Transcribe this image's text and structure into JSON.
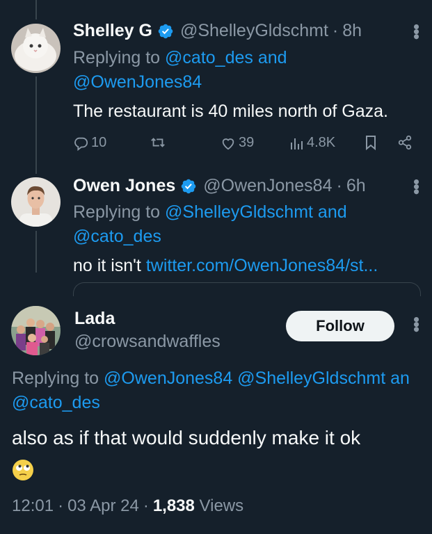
{
  "tweets": [
    {
      "name": "Shelley G",
      "handle": "@ShelleyGldschmt",
      "time": "8h",
      "reply_prefix": "Replying to ",
      "reply_line1_link": "@cato_des and",
      "reply_line2_link": "@OwenJones84",
      "text": "The restaurant is 40 miles north of Gaza.",
      "stats": {
        "replies": "10",
        "likes": "39",
        "views": "4.8K"
      }
    },
    {
      "name": "Owen Jones",
      "handle": "@OwenJones84",
      "time": "6h",
      "reply_prefix": "Replying to ",
      "reply_line1_link": "@ShelleyGldschmt and",
      "reply_line2_link": "@cato_des",
      "text_prefix": "no it isn't ",
      "text_link": "twitter.com/OwenJones84/st..."
    }
  ],
  "main_tweet": {
    "name": "Lada",
    "handle": "@crowsandwaffles",
    "follow_label": "Follow",
    "reply_prefix": "Replying to ",
    "reply_line1_link": "@OwenJones84 @ShelleyGldschmt an",
    "reply_line2_link": "@cato_des",
    "text": "also as if that would suddenly make it ok",
    "time": "12:01",
    "date": "03 Apr 24",
    "views_count": "1,838",
    "views_label": " Views"
  },
  "separator": "·",
  "colors": {
    "background": "#15202b",
    "accent": "#1d9bf0",
    "muted": "#8b98a5",
    "text": "#f7f9f9"
  },
  "icons": [
    "verified-badge-icon",
    "more-options-icon",
    "reply-icon",
    "retweet-icon",
    "like-icon",
    "views-icon",
    "bookmark-icon",
    "share-icon",
    "eye-roll-emoji"
  ]
}
